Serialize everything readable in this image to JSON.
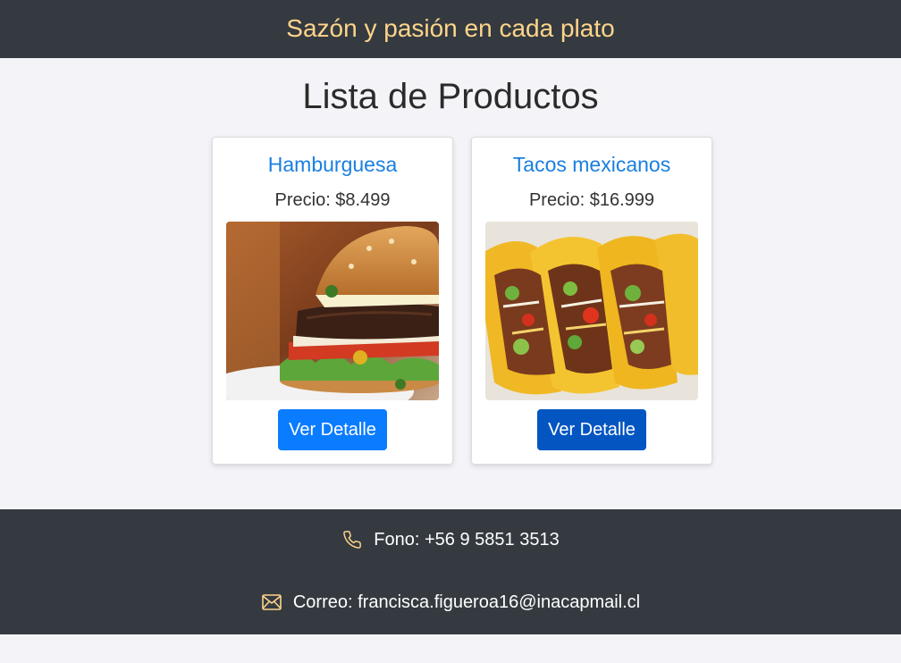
{
  "header": {
    "slogan": "Sazón y pasión en cada plato"
  },
  "main": {
    "title": "Lista de Productos",
    "products": [
      {
        "name": "Hamburguesa",
        "price": "Precio: $8.499",
        "image": "hamburger-photo",
        "button_label": "Ver Detalle"
      },
      {
        "name": "Tacos mexicanos",
        "price": "Precio: $16.999",
        "image": "tacos-photo",
        "button_label": "Ver Detalle"
      }
    ]
  },
  "footer": {
    "phone_icon": "phone-icon",
    "phone": "Fono: +56 9 5851 3513",
    "mail_icon": "envelope-icon",
    "email": "Correo: francisca.figueroa16@inacapmail.cl"
  },
  "colors": {
    "header_bg": "#343a40",
    "slogan": "#ffd58a",
    "link_blue": "#1a7fe0",
    "button_primary": "#0a7cff",
    "button_hover": "#0356c2",
    "page_bg": "#f4f4f8"
  }
}
